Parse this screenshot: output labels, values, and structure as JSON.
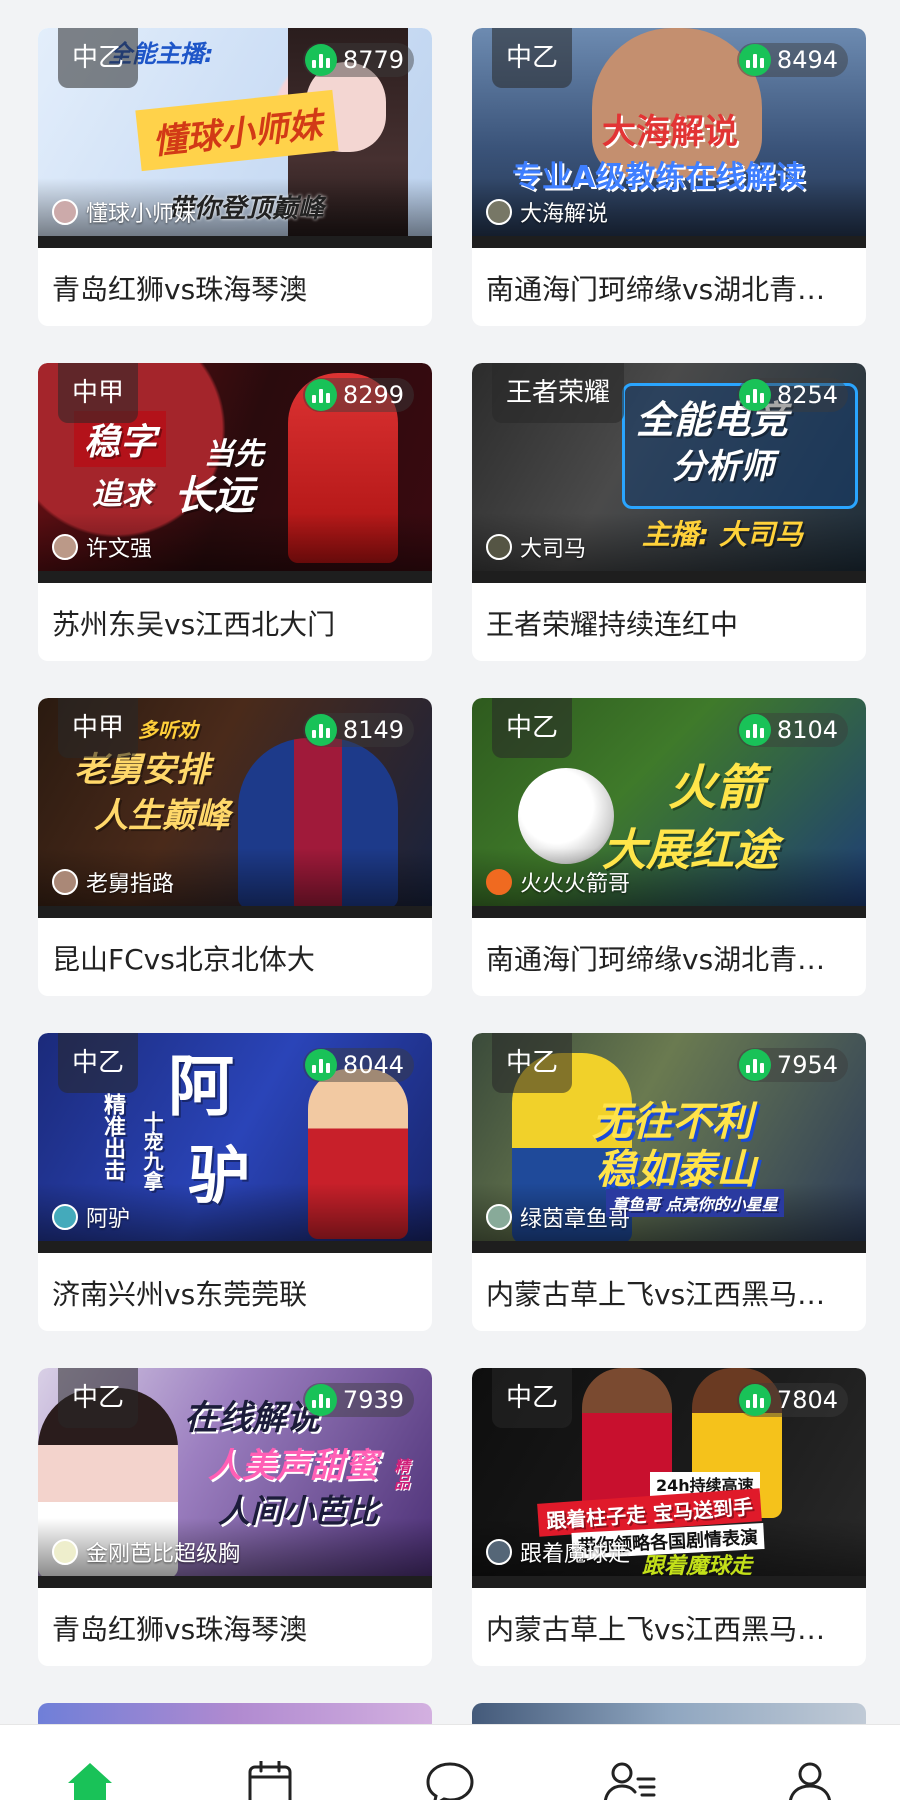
{
  "colors": {
    "accent": "#19c258",
    "background": "#f2f3f5",
    "card": "#ffffff",
    "title_text": "#222222"
  },
  "live_list": [
    {
      "league": "中乙",
      "viewers": "8779",
      "anchor": "懂球小师妹",
      "title": "青岛红狮vs珠海琴澳",
      "promo": [
        "全能主播:",
        "懂球小师妹",
        "带你登顶巅峰"
      ]
    },
    {
      "league": "中乙",
      "viewers": "8494",
      "anchor": "大海解说",
      "title": "南通海门珂缔缘vs湖北青…",
      "promo": [
        "大海解说",
        "专业A级教练在线解读"
      ]
    },
    {
      "league": "中甲",
      "viewers": "8299",
      "anchor": "许文强",
      "title": "苏州东吴vs江西北大门",
      "promo": [
        "稳字",
        "当先",
        "追求",
        "长远"
      ]
    },
    {
      "league": "王者荣耀",
      "viewers": "8254",
      "anchor": "大司马",
      "title": "王者荣耀持续连红中",
      "promo": [
        "全能电竞",
        "分析师",
        "主播: 大司马"
      ]
    },
    {
      "league": "中甲",
      "viewers": "8149",
      "anchor": "老舅指路",
      "title": "昆山FCvs北京北体大",
      "promo": [
        "多听劝",
        "老舅安排",
        "人生巅峰"
      ]
    },
    {
      "league": "中乙",
      "viewers": "8104",
      "anchor": "火火火箭哥",
      "title": "南通海门珂缔缘vs湖北青…",
      "promo": [
        "火箭",
        "大展红途"
      ]
    },
    {
      "league": "中乙",
      "viewers": "8044",
      "anchor": "阿驴",
      "title": "济南兴州vs东莞莞联",
      "promo": [
        "阿",
        "驴",
        "精准出击",
        "十宠九拿"
      ]
    },
    {
      "league": "中乙",
      "viewers": "7954",
      "anchor": "绿茵章鱼哥",
      "title": "内蒙古草上飞vs江西黑马…",
      "promo": [
        "无往不利",
        "稳如泰山",
        "章鱼哥 点亮你的小星星"
      ]
    },
    {
      "league": "中乙",
      "viewers": "7939",
      "anchor": "金刚芭比超级胸",
      "title": "青岛红狮vs珠海琴澳",
      "promo": [
        "在线解说",
        "人美声甜蜜",
        "人间小芭比",
        "精品"
      ]
    },
    {
      "league": "中乙",
      "viewers": "7804",
      "anchor": "跟着魔球走",
      "title": "内蒙古草上飞vs江西黑马…",
      "promo": [
        "24h持续高速",
        "跟着柱子走 宝马送到手",
        "带你领略各国剧情表演",
        "跟着魔球走"
      ]
    }
  ],
  "tab_bar": [
    {
      "name": "home",
      "icon": "home-icon",
      "active": true
    },
    {
      "name": "schedule",
      "icon": "calendar-icon",
      "active": false
    },
    {
      "name": "messages",
      "icon": "chat-bubble-icon",
      "active": false
    },
    {
      "name": "following",
      "icon": "user-list-icon",
      "active": false
    },
    {
      "name": "profile",
      "icon": "user-icon",
      "active": false
    }
  ]
}
